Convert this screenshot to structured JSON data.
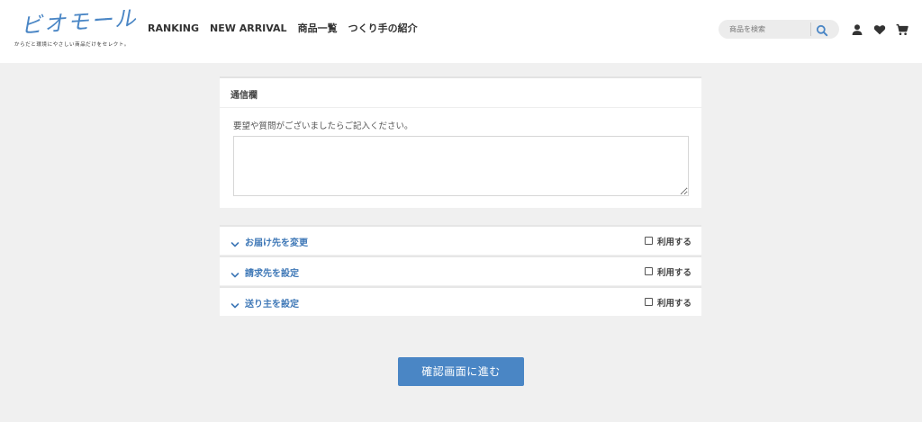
{
  "header": {
    "logo_text": "ビオモール",
    "logo_tagline": "からだと環境にやさしい商品だけをセレクト。",
    "nav": [
      "RANKING",
      "NEW ARRIVAL",
      "商品一覧",
      "つくり手の紹介"
    ],
    "search_placeholder": "商品を検索",
    "icons": [
      "search-icon",
      "user-icon",
      "heart-icon",
      "cart-icon"
    ]
  },
  "message_panel": {
    "title": "通信欄",
    "description": "要望や質問がございましたらご記入ください。",
    "textarea_value": ""
  },
  "accordions": [
    {
      "label": "お届け先を変更",
      "checkbox_label": "利用する",
      "checked": false
    },
    {
      "label": "請求先を設定",
      "checkbox_label": "利用する",
      "checked": false
    },
    {
      "label": "送り主を設定",
      "checkbox_label": "利用する",
      "checked": false
    }
  ],
  "confirm_button": "確認画面に進む",
  "colors": {
    "accent": "#4a86c5",
    "link": "#3f78b7",
    "background": "#f0f0f0"
  }
}
